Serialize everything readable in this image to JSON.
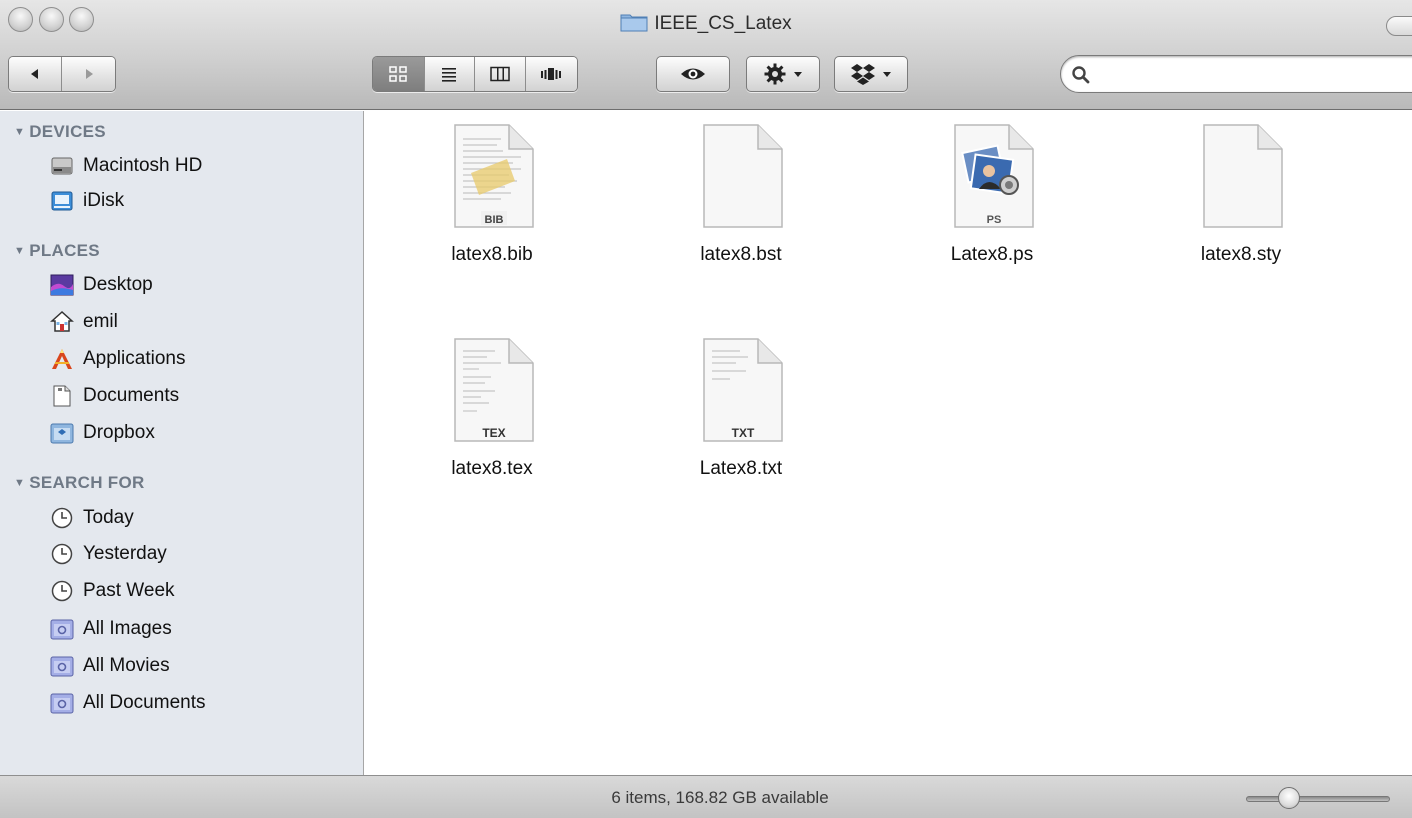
{
  "window": {
    "title": "IEEE_CS_Latex"
  },
  "toolbar": {
    "back_icon": "back-arrow-icon",
    "forward_icon": "forward-arrow-icon",
    "view_modes": [
      "icon-view-icon",
      "list-view-icon",
      "column-view-icon",
      "coverflow-view-icon"
    ],
    "active_view": "icon-view-icon",
    "quicklook_icon": "eye-icon",
    "action_icon": "gear-icon",
    "dropbox_icon": "dropbox-icon",
    "search_placeholder": "",
    "search_value": ""
  },
  "sidebar": {
    "devices_header": "DEVICES",
    "devices": [
      {
        "label": "Macintosh HD",
        "icon": "hard-drive-icon"
      },
      {
        "label": "iDisk",
        "icon": "idisk-icon"
      }
    ],
    "places_header": "PLACES",
    "places": [
      {
        "label": "Desktop",
        "icon": "desktop-icon"
      },
      {
        "label": "emil",
        "icon": "home-icon"
      },
      {
        "label": "Applications",
        "icon": "applications-icon"
      },
      {
        "label": "Documents",
        "icon": "documents-icon"
      },
      {
        "label": "Dropbox",
        "icon": "dropbox-folder-icon"
      }
    ],
    "search_header": "SEARCH FOR",
    "searches": [
      {
        "label": "Today",
        "icon": "clock-icon"
      },
      {
        "label": "Yesterday",
        "icon": "clock-icon"
      },
      {
        "label": "Past Week",
        "icon": "clock-icon"
      },
      {
        "label": "All Images",
        "icon": "smart-folder-icon"
      },
      {
        "label": "All Movies",
        "icon": "smart-folder-icon"
      },
      {
        "label": "All Documents",
        "icon": "smart-folder-icon"
      }
    ]
  },
  "files": [
    {
      "name": "latex8.bib",
      "badge": "BIB",
      "icon": "bib-file-icon"
    },
    {
      "name": "latex8.bst",
      "badge": "",
      "icon": "blank-file-icon"
    },
    {
      "name": "Latex8.ps",
      "badge": "PS",
      "icon": "ps-file-icon"
    },
    {
      "name": "latex8.sty",
      "badge": "",
      "icon": "blank-file-icon"
    },
    {
      "name": "latex8.tex",
      "badge": "TEX",
      "icon": "tex-file-icon"
    },
    {
      "name": "Latex8.txt",
      "badge": "TXT",
      "icon": "txt-file-icon"
    }
  ],
  "status": {
    "text": "6 items, 168.82 GB available",
    "icon_size_level": 0.3
  }
}
